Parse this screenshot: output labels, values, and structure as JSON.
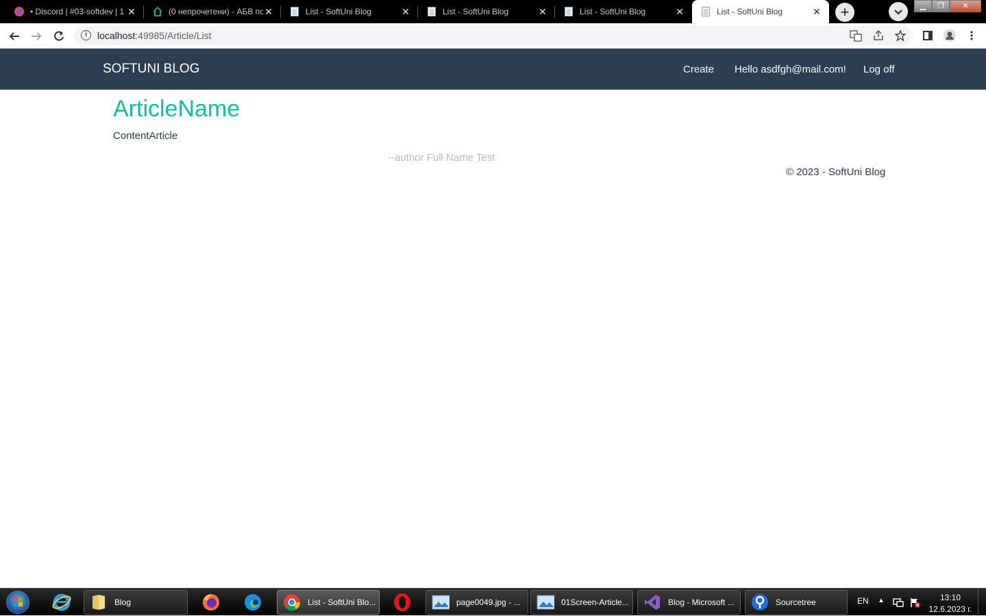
{
  "browser": {
    "tabs": [
      {
        "title": "• Discord | #03-softdev | 1",
        "icon": "discord-icon",
        "active": false
      },
      {
        "title": "(0 непрочетени) - АБВ по",
        "icon": "home-icon",
        "active": false
      },
      {
        "title": "List - SoftUni Blog",
        "icon": "document-icon",
        "active": false
      },
      {
        "title": "List - SoftUni Blog",
        "icon": "document-icon",
        "active": false
      },
      {
        "title": "List - SoftUni Blog",
        "icon": "document-icon",
        "active": false
      },
      {
        "title": "List - SoftUni Blog",
        "icon": "document-icon",
        "active": true
      }
    ],
    "address": {
      "host": "localhost",
      "path": ":49985/Article/List"
    }
  },
  "site": {
    "brand": "SOFTUNI BLOG",
    "nav": {
      "create": "Create",
      "hello": "Hello asdfgh@mail.com!",
      "logoff": "Log off"
    }
  },
  "article": {
    "title": "ArticleName",
    "content": "ContentArticle",
    "author": "--author Full Name Test"
  },
  "footer": {
    "text": "© 2023 - SoftUni Blog"
  },
  "colors": {
    "navbar": "#2c3e50",
    "title": "#18bc9c",
    "author": "#b4bcc2"
  },
  "taskbar": {
    "items": [
      {
        "label": "Blog",
        "icon": "folder-icon"
      },
      {
        "label": "List - SoftUni Blo...",
        "icon": "chrome-icon"
      },
      {
        "label": "page0049.jpg - ...",
        "icon": "image-viewer-icon"
      },
      {
        "label": "01Screen-Article...",
        "icon": "image-viewer-icon"
      },
      {
        "label": "Blog - Microsoft ...",
        "icon": "visual-studio-icon"
      },
      {
        "label": "Sourcetree",
        "icon": "sourcetree-icon"
      }
    ],
    "language": "EN",
    "time": "13:10",
    "date": "12.6.2023 г."
  }
}
